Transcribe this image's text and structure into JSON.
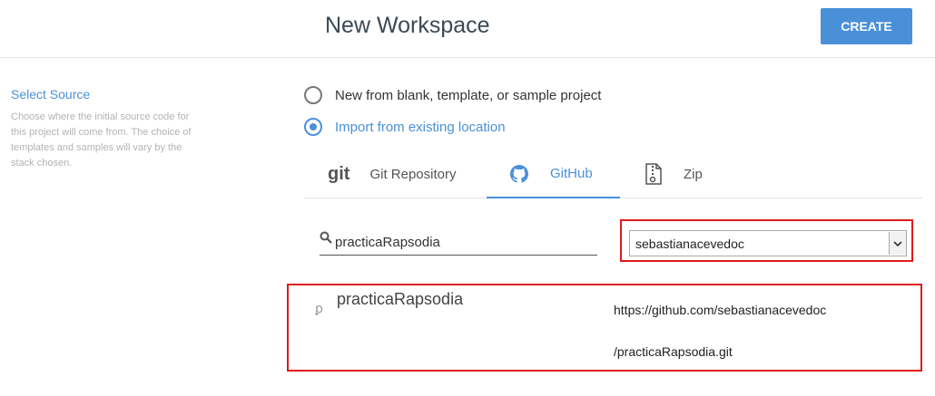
{
  "header": {
    "title": "New Workspace",
    "create_label": "CREATE"
  },
  "sidebar": {
    "title": "Select Source",
    "description": "Choose where the initial source code for this project will come from. The choice of templates and samples will vary by the stack chosen."
  },
  "source_options": [
    {
      "label": "New from blank, template, or sample project",
      "selected": false
    },
    {
      "label": "Import from existing location",
      "selected": true
    }
  ],
  "tabs": [
    {
      "label": "Git Repository",
      "icon": "git-icon",
      "icon_text": "git"
    },
    {
      "label": "GitHub",
      "icon": "github-icon",
      "active": true
    },
    {
      "label": "Zip",
      "icon": "zip-file-icon"
    }
  ],
  "github": {
    "search_value": "practicaRapsodia",
    "account_value": "sebastianacevedoc",
    "repository": {
      "name": "practicaRapsodia",
      "url_line1": "https://github.com/sebastianacevedoc",
      "url_line2": "/practicaRapsodia.git"
    }
  },
  "colors": {
    "accent": "#4a90d9",
    "highlight": "#e01b1b"
  }
}
